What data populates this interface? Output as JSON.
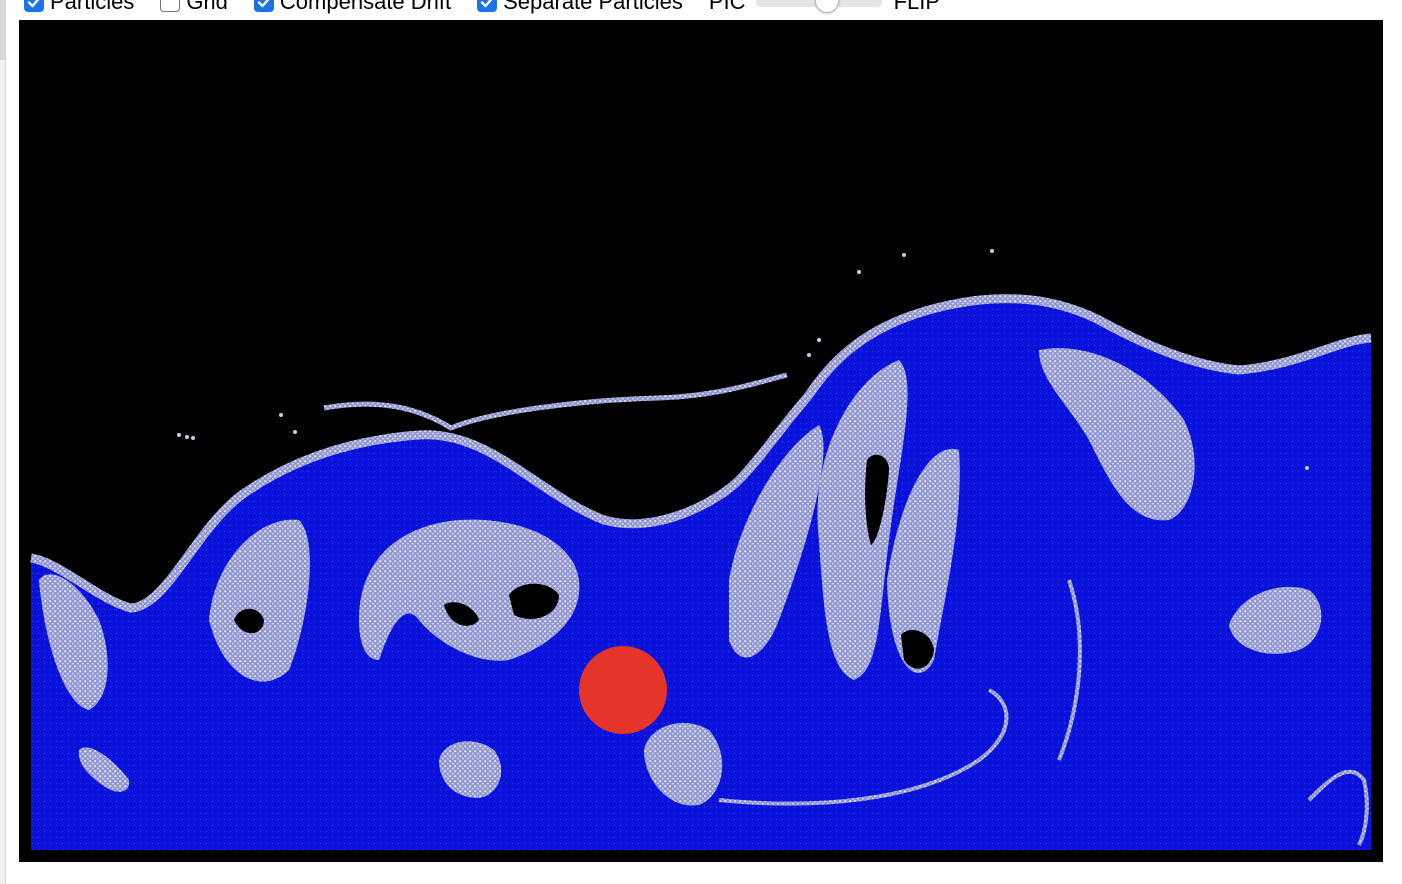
{
  "controls": {
    "particles": {
      "label": "Particles",
      "checked": true
    },
    "grid": {
      "label": "Grid",
      "checked": false
    },
    "compensate_drift": {
      "label": "Compensate Drift",
      "checked": true
    },
    "separate_particles": {
      "label": "Separate Particles",
      "checked": true
    },
    "flip_ratio": {
      "min_label": "PIC",
      "max_label": "FLIP",
      "value": 0.58
    }
  },
  "colors": {
    "accent": "#1a73e8",
    "background": "#000000",
    "fluid": "#0a12dc",
    "particle_light": "#c8cce8",
    "obstacle": "#e5342a"
  }
}
